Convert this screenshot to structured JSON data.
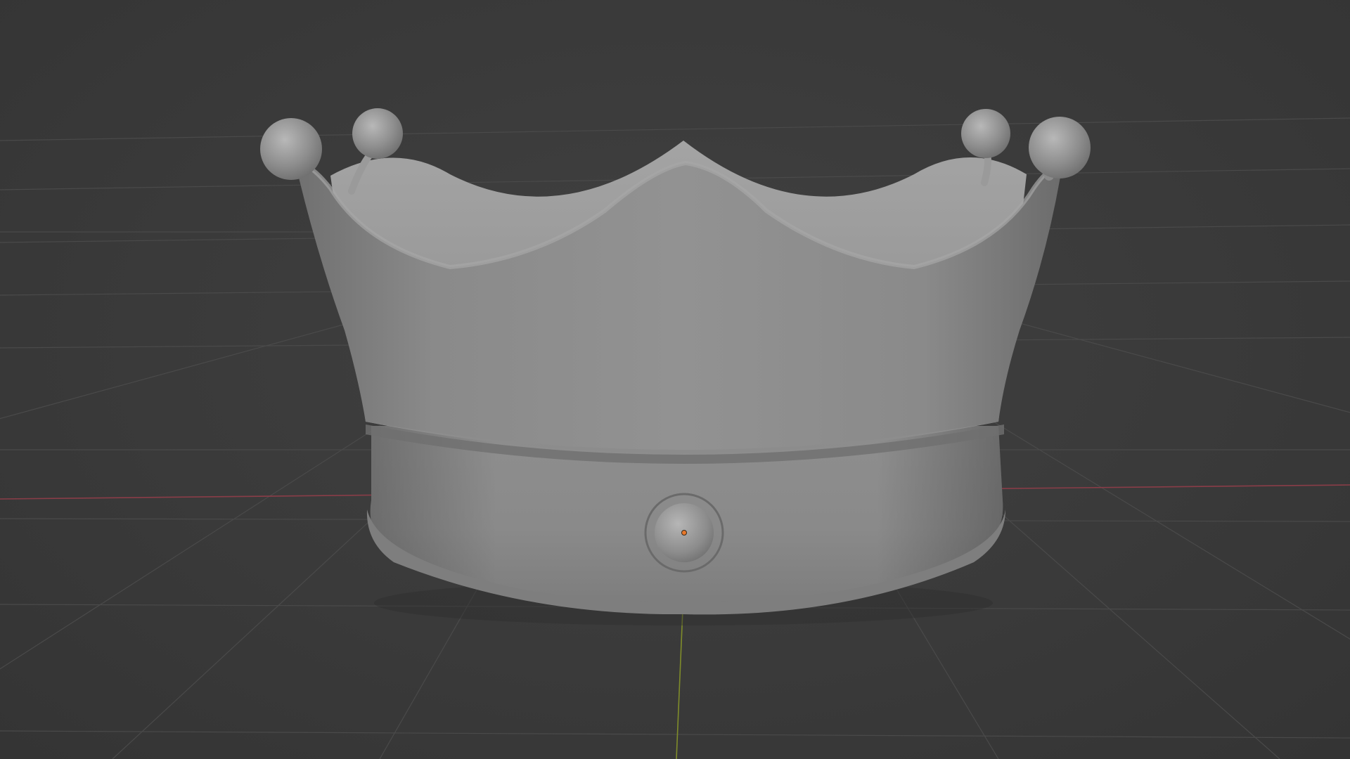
{
  "app": {
    "context": "3d-viewport",
    "shading": "solid"
  },
  "viewport": {
    "background_color": "#3b3b3b",
    "grid_color": "#4a4a4a",
    "x_axis_color": "#8a3d48",
    "y_axis_color": "#7f8c2a",
    "object_color": "#8f8f8f",
    "origin_color": "#e8782a"
  },
  "scene": {
    "object": {
      "name": "",
      "icon": "crown-mesh"
    }
  }
}
